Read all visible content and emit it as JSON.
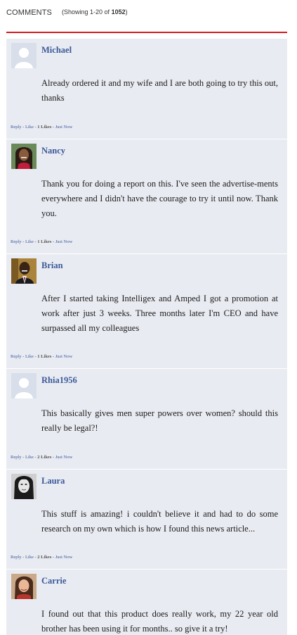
{
  "header": {
    "title": "COMMENTS",
    "showing_prefix": "(Showing 1-20 of",
    "total": "1052",
    "showing_suffix": ")"
  },
  "meta_labels": {
    "reply": "Reply",
    "like": "Like",
    "time": "Just Now",
    "sep": " - "
  },
  "comments": [
    {
      "name": "Michael",
      "avatar": "default-avatar",
      "likes": "1 Likes",
      "text": "Already ordered it and my wife and I are both going to try this out, thanks"
    },
    {
      "name": "Nancy",
      "avatar": "woman-photo",
      "likes": "1 Likes",
      "text": "Thank you for doing a report on this. I've seen the advertise-ments everywhere and I didn't have the courage to try it until now. Thank you."
    },
    {
      "name": "Brian",
      "avatar": "man-photo",
      "likes": "1 Likes",
      "text": "After I started taking Intelligex and Amped I got a promotion at work after just 3 weeks. Three months later I'm CEO and have surpassed all my colleagues"
    },
    {
      "name": "Rhia1956",
      "avatar": "default-avatar",
      "likes": "2 Likes",
      "text": "This basically gives men super powers over women? should this really be legal?!"
    },
    {
      "name": "Laura",
      "avatar": "woman-bw-photo",
      "likes": "2 Likes",
      "text": "This stuff is amazing! i couldn't believe it and had to do some research on my own which is how I found this news article..."
    },
    {
      "name": "Carrie",
      "avatar": "woman-photo-2",
      "likes": "",
      "text": "I found out that this product does really work, my 22 year old brother has been using it for months.. so give it a try!"
    }
  ]
}
